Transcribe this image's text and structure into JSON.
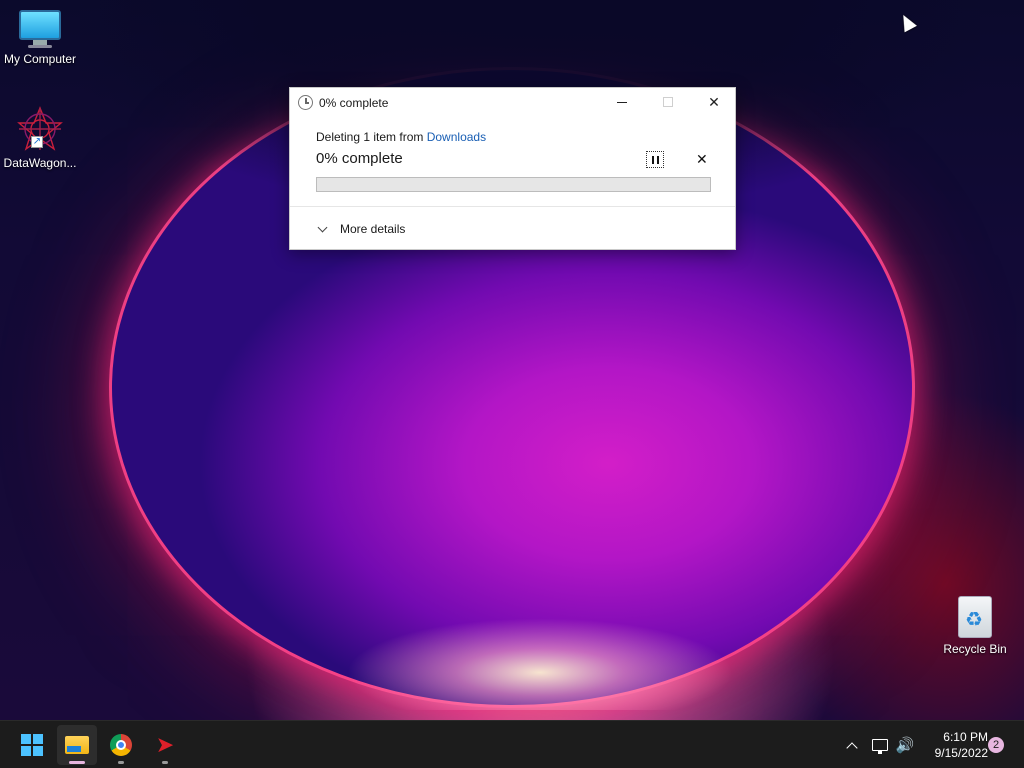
{
  "desktop": {
    "icons": [
      {
        "label": "My Computer",
        "icon": "monitor-icon"
      },
      {
        "label": "DataWagon...",
        "icon": "datawagon-logo-icon"
      },
      {
        "label": "Recycle Bin",
        "icon": "recycle-bin-icon"
      }
    ]
  },
  "dialog": {
    "title": "0% complete",
    "title_icon": "clock-icon",
    "deleting_prefix": "Deleting 1 item from ",
    "deleting_location": "Downloads",
    "progress_text": "0% complete",
    "progress_value": 0,
    "more_details": "More details",
    "link_color": "#1a5fb4"
  },
  "taskbar": {
    "apps": [
      {
        "name": "Start",
        "icon": "windows-start-icon"
      },
      {
        "name": "File Explorer",
        "icon": "file-explorer-icon"
      },
      {
        "name": "Google Chrome",
        "icon": "chrome-icon"
      },
      {
        "name": "Red App",
        "icon": "red-app-icon"
      }
    ],
    "time": "6:10 PM",
    "date": "9/15/2022",
    "notification_count": "2"
  }
}
